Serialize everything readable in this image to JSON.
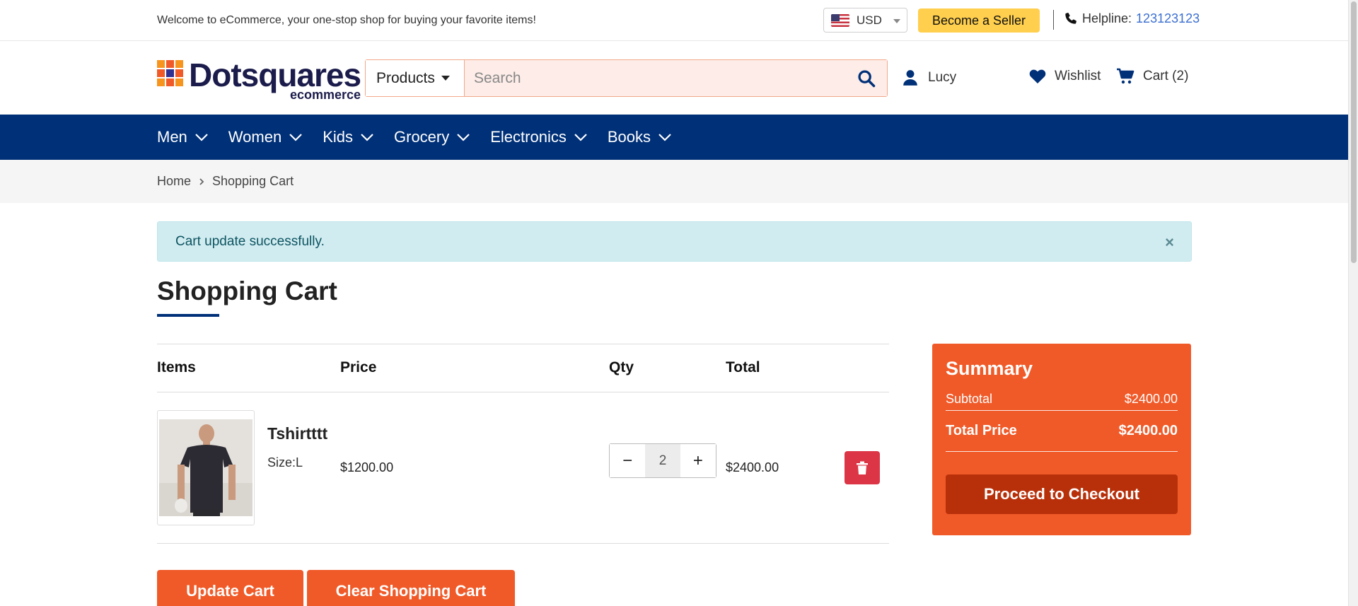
{
  "topbar": {
    "welcome": "Welcome to eCommerce, your one-stop shop for buying your favorite items!",
    "currency": "USD",
    "become_seller": "Become a Seller",
    "helpline_label": "Helpline:",
    "helpline_number": "123123123"
  },
  "header": {
    "logo_brand": "Dotsquares",
    "logo_sub": "ecommerce",
    "search_category": "Products",
    "search_placeholder": "Search",
    "user_name": "Lucy",
    "wishlist_label": "Wishlist",
    "cart_label": "Cart (2)"
  },
  "nav": {
    "items": [
      {
        "label": "Men"
      },
      {
        "label": "Women"
      },
      {
        "label": "Kids"
      },
      {
        "label": "Grocery"
      },
      {
        "label": "Electronics"
      },
      {
        "label": "Books"
      }
    ]
  },
  "breadcrumb": {
    "home": "Home",
    "current": "Shopping Cart"
  },
  "alert": {
    "message": "Cart update successfully.",
    "close": "×"
  },
  "cart": {
    "title": "Shopping Cart",
    "columns": {
      "items": "Items",
      "price": "Price",
      "qty": "Qty",
      "total": "Total"
    },
    "items": [
      {
        "name": "Tshirtttt",
        "size": "Size:L",
        "price": "$1200.00",
        "qty": "2",
        "total": "$2400.00"
      }
    ],
    "qty_minus": "−",
    "qty_plus": "+",
    "update_button": "Update Cart",
    "clear_button": "Clear Shopping Cart"
  },
  "summary": {
    "title": "Summary",
    "subtotal_label": "Subtotal",
    "subtotal_value": "$2400.00",
    "total_label": "Total Price",
    "total_value": "$2400.00",
    "checkout_button": "Proceed to Checkout"
  },
  "colors": {
    "nav_bg": "#003078",
    "accent_orange": "#f05a28",
    "checkout_dark": "#b8300a",
    "seller_yellow": "#ffcf4d",
    "delete_red": "#dc3545",
    "alert_bg": "#d1ecf1"
  },
  "icons": {
    "phone": "phone-icon",
    "search": "search-icon",
    "user": "user-icon",
    "wishlist": "heart-icon",
    "cart": "cart-icon",
    "delete": "trash-icon",
    "nav_chevron": "chevron-down-icon"
  }
}
